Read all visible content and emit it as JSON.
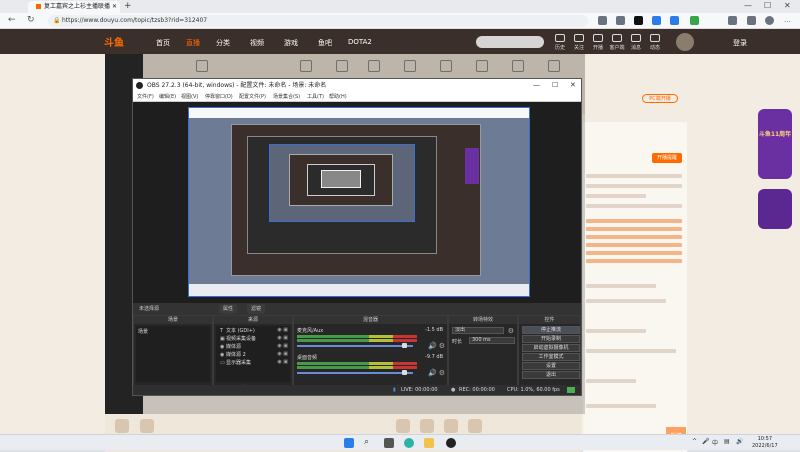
{
  "browser": {
    "tab_title": "复工嘉宾之上衫主播联播",
    "url": "https://www.douyu.com/topic/tzsb3?rid=312407"
  },
  "site": {
    "logo": "斗鱼",
    "nav": [
      "首页",
      "直播",
      "分类",
      "视频",
      "游戏",
      "鱼吧",
      "DOTA2"
    ],
    "header_icons": [
      "历史",
      "关注",
      "开播",
      "客户端",
      "消息",
      "动态",
      "我的"
    ],
    "login": "登录",
    "room_number": "12",
    "pc_button": "PC端开播",
    "chat_button": "开播提醒",
    "send_label": "发送",
    "badge_text": "斗鱼11周年"
  },
  "obs": {
    "title": "OBS 27.2.3 (64-bit, windows) - 配置文件: 未命名 - 场景: 未命名",
    "menu": [
      "文件(F)",
      "编辑(E)",
      "视图(V)",
      "停靠窗口(D)",
      "配置文件(P)",
      "场景集合(S)",
      "工具(T)",
      "帮助(H)"
    ],
    "tabs": [
      "未选择源",
      "属性",
      "滤镜"
    ],
    "docks": {
      "scenes_title": "场景",
      "sources_title": "来源",
      "mixer_title": "混音器",
      "transitions_title": "转场特效",
      "controls_title": "控件"
    },
    "scenes": [
      "场景"
    ],
    "sources": [
      {
        "glyph": "T",
        "name": "文本 (GDI+)"
      },
      {
        "glyph": "▣",
        "name": "视频采集设备"
      },
      {
        "glyph": "◉",
        "name": "媒体源"
      },
      {
        "glyph": "◉",
        "name": "媒体源 2"
      },
      {
        "glyph": "▭",
        "name": "显示器采集"
      }
    ],
    "mixer": [
      {
        "name": "麦克风/Aux",
        "db": "-1.5 dB"
      },
      {
        "name": "桌面音频",
        "db": "-9.7 dB"
      }
    ],
    "transition": {
      "type_value": "淡出",
      "duration_label": "时长",
      "duration_value": "300 ms"
    },
    "controls": [
      "停止推流",
      "开始录制",
      "启动虚拟摄像机",
      "工作室模式",
      "设置",
      "退出"
    ],
    "status": {
      "live": "LIVE: 00:00:00",
      "rec": "REC: 00:00:00",
      "cpu": "CPU: 1.0%, 60.00 fps"
    },
    "dock_footer_icons": "+ − ⌃ ⌄",
    "sources_footer_icons": "+ − ⚙ ⌃ ⌄"
  },
  "taskbar": {
    "time": "10:57",
    "date": "2022/6/17",
    "ime": "中",
    "tray_up": "^"
  }
}
